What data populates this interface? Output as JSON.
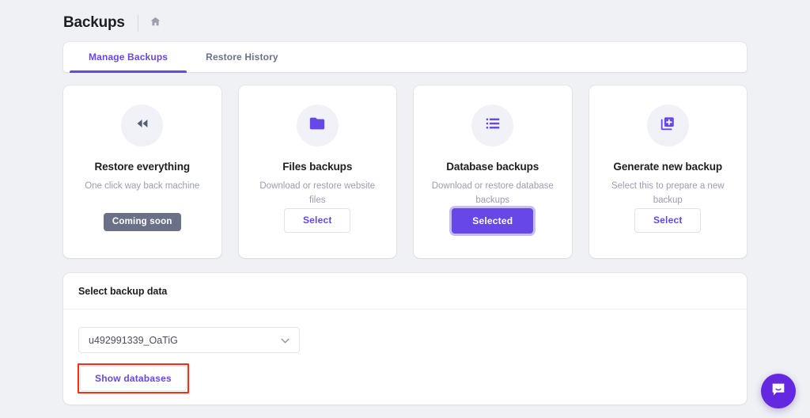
{
  "header": {
    "title": "Backups",
    "home_icon": "home-icon"
  },
  "tabs": [
    {
      "label": "Manage Backups",
      "active": true
    },
    {
      "label": "Restore History",
      "active": false
    }
  ],
  "cards": [
    {
      "icon": "rewind-icon",
      "title": "Restore everything",
      "description": "One click way back machine",
      "action_type": "badge",
      "action_label": "Coming soon"
    },
    {
      "icon": "folder-icon",
      "title": "Files backups",
      "description": "Download or restore website files",
      "action_type": "select",
      "action_label": "Select"
    },
    {
      "icon": "list-icon",
      "title": "Database backups",
      "description": "Download or restore database backups",
      "action_type": "selected",
      "action_label": "Selected"
    },
    {
      "icon": "library-add-icon",
      "title": "Generate new backup",
      "description": "Select this to prepare a new backup",
      "action_type": "select",
      "action_label": "Select"
    }
  ],
  "panel": {
    "heading": "Select backup data",
    "database_select": {
      "value": "u492991339_OaTiG",
      "caret_icon": "chevron-down-icon"
    },
    "show_databases_label": "Show databases"
  },
  "chat": {
    "icon": "chat-bubble-icon"
  },
  "colors": {
    "accent": "#6747e7",
    "page_background": "#f0f1f5",
    "badge_grey": "#6b7089",
    "annotation_red": "#ff2d16",
    "chat_purple": "#6428e0"
  }
}
